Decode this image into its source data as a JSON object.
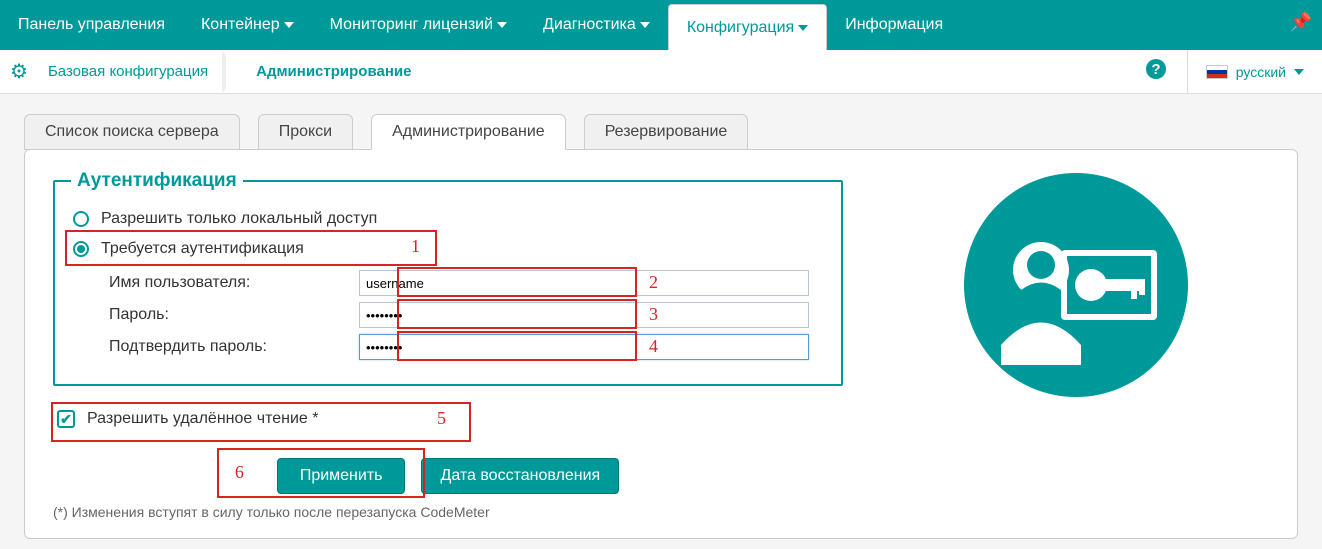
{
  "topnav": {
    "items": [
      {
        "label": "Панель управления",
        "dropdown": false
      },
      {
        "label": "Контейнер",
        "dropdown": true
      },
      {
        "label": "Мониторинг лицензий",
        "dropdown": true
      },
      {
        "label": "Диагностика",
        "dropdown": true
      },
      {
        "label": "Конфигурация",
        "dropdown": true,
        "active": true
      },
      {
        "label": "Информация",
        "dropdown": false
      }
    ]
  },
  "breadcrumb": {
    "base": "Базовая конфигурация",
    "current": "Администрирование"
  },
  "language": "русский",
  "tabs": {
    "items": [
      "Список поиска сервера",
      "Прокси",
      "Администрирование",
      "Резервирование"
    ],
    "active_index": 2
  },
  "auth_fieldset": {
    "legend": "Аутентификация",
    "radio_local": "Разрешить только локальный доступ",
    "radio_auth": "Требуется аутентификация",
    "username_label": "Имя пользователя:",
    "username_value": "username",
    "password_label": "Пароль:",
    "password_value": "••••••••",
    "confirm_label": "Подтвердить пароль:",
    "confirm_value": "••••••••"
  },
  "remote_read": {
    "label": "Разрешить удалённое чтение *"
  },
  "buttons": {
    "apply": "Применить",
    "restore": "Дата восстановления"
  },
  "footnote": "(*) Изменения вступят в силу только после перезапуска CodeMeter",
  "annotations": {
    "n1": "1",
    "n2": "2",
    "n3": "3",
    "n4": "4",
    "n5": "5",
    "n6": "6"
  }
}
